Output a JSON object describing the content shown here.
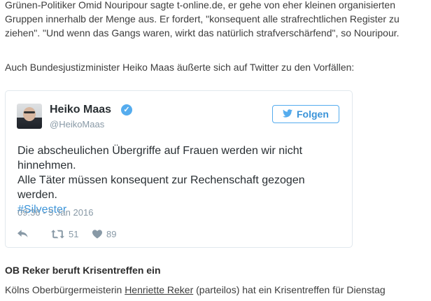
{
  "article": {
    "p1": "Grünen-Politiker Omid Nouripour sagte t-online.de, er gehe von eher kleinen organisierten Gruppen innerhalb der Menge aus. Er fordert, \"konsequent alle strafrechtlichen Register zu ziehen\". \"Und wenn das Gangs waren, wirkt das natürlich strafverschärfend\", so Nouripour.",
    "p2": "Auch Bundesjustizminister Heiko Maas äußerte sich auf Twitter zu den Vorfällen:",
    "heading": "OB Reker beruft Krisentreffen ein",
    "p3_before": "Kölns Oberbürgermeisterin ",
    "p3_link": "Henriette Reker",
    "p3_after": " (parteilos) hat ein Krisentreffen für Dienstag"
  },
  "tweet": {
    "name": "Heiko Maas",
    "handle": "@HeikoMaas",
    "follow_label": "Folgen",
    "line1": "Die abscheulichen Übergriffe auf Frauen werden wir nicht hinnehmen.",
    "line2": "Alle Täter müssen konsequent zur Rechenschaft gezogen werden.",
    "hashtag": "#Silvester",
    "date": "09:36 - 5 Jan 2016",
    "retweets": "51",
    "likes": "89",
    "icons": {
      "verified": "verified-badge-icon",
      "bird": "twitter-bird-icon",
      "reply": "reply-icon",
      "retweet": "retweet-icon",
      "like": "heart-icon"
    },
    "colors": {
      "accent": "#55acee",
      "link": "#3b94d9",
      "muted": "#8899a6"
    }
  }
}
